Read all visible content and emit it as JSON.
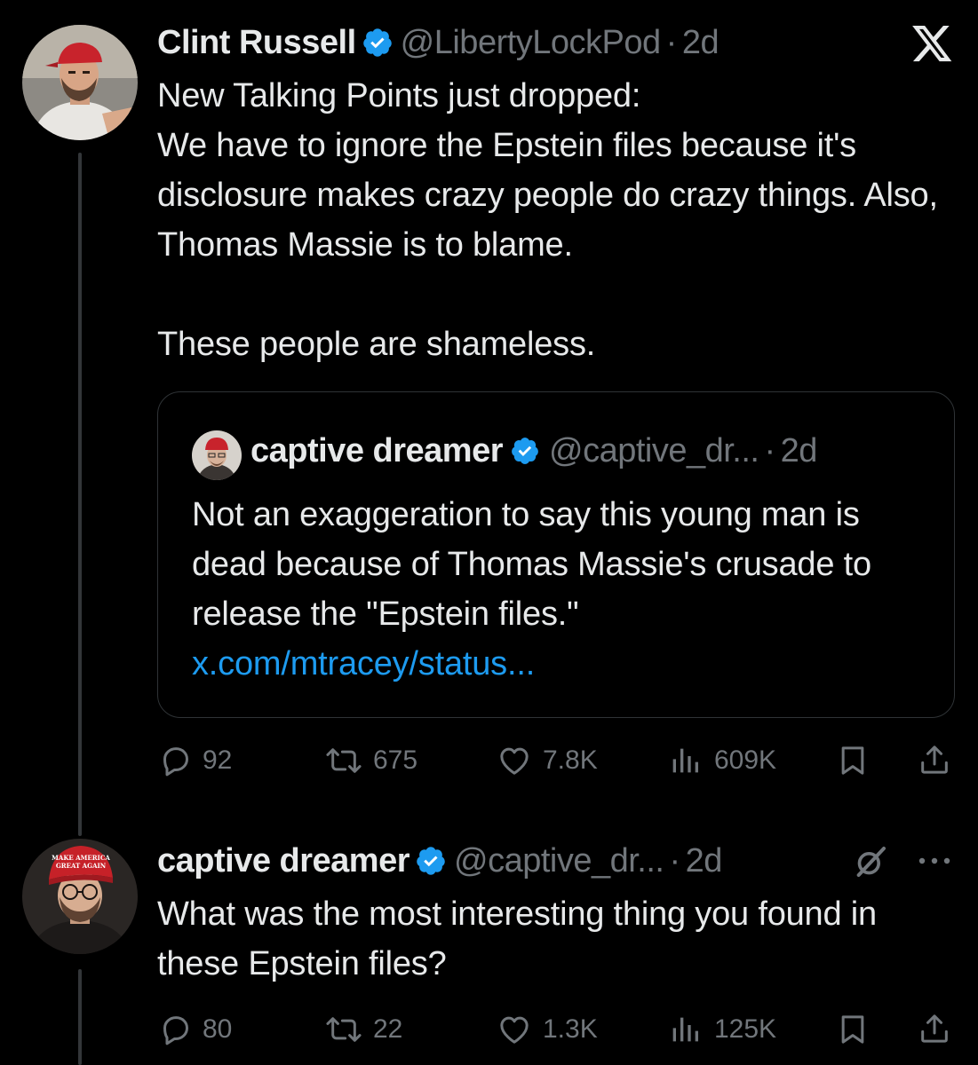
{
  "tweet1": {
    "name": "Clint Russell",
    "handle": "@LibertyLockPod",
    "separator": "·",
    "time": "2d",
    "text": "New Talking Points just dropped:\nWe have to ignore the Epstein files because it's disclosure makes crazy people do crazy things. Also, Thomas Massie is to blame.\n\nThese people are shameless.",
    "quote": {
      "name": "captive dreamer",
      "handle": "@captive_dr...",
      "separator": "·",
      "time": "2d",
      "text": "Not an exaggeration to say this young man is dead because of Thomas Massie's crusade to release the \"Epstein files.\"",
      "link": "x.com/mtracey/status..."
    },
    "stats": {
      "replies": "92",
      "reposts": "675",
      "likes": "7.8K",
      "views": "609K"
    }
  },
  "tweet2": {
    "name": "captive dreamer",
    "handle": "@captive_dr...",
    "separator": "·",
    "time": "2d",
    "text": "What was the most interesting thing you found in these Epstein files?",
    "hat_text": "MAKE AMERICA GREAT AGAIN",
    "stats": {
      "replies": "80",
      "reposts": "22",
      "likes": "1.3K",
      "views": "125K"
    }
  },
  "colors": {
    "background": "#000000",
    "text": "#e7e9ea",
    "muted": "#71767b",
    "link": "#1d9bf0",
    "verified": "#1d9bf0",
    "border": "#2f3336"
  }
}
